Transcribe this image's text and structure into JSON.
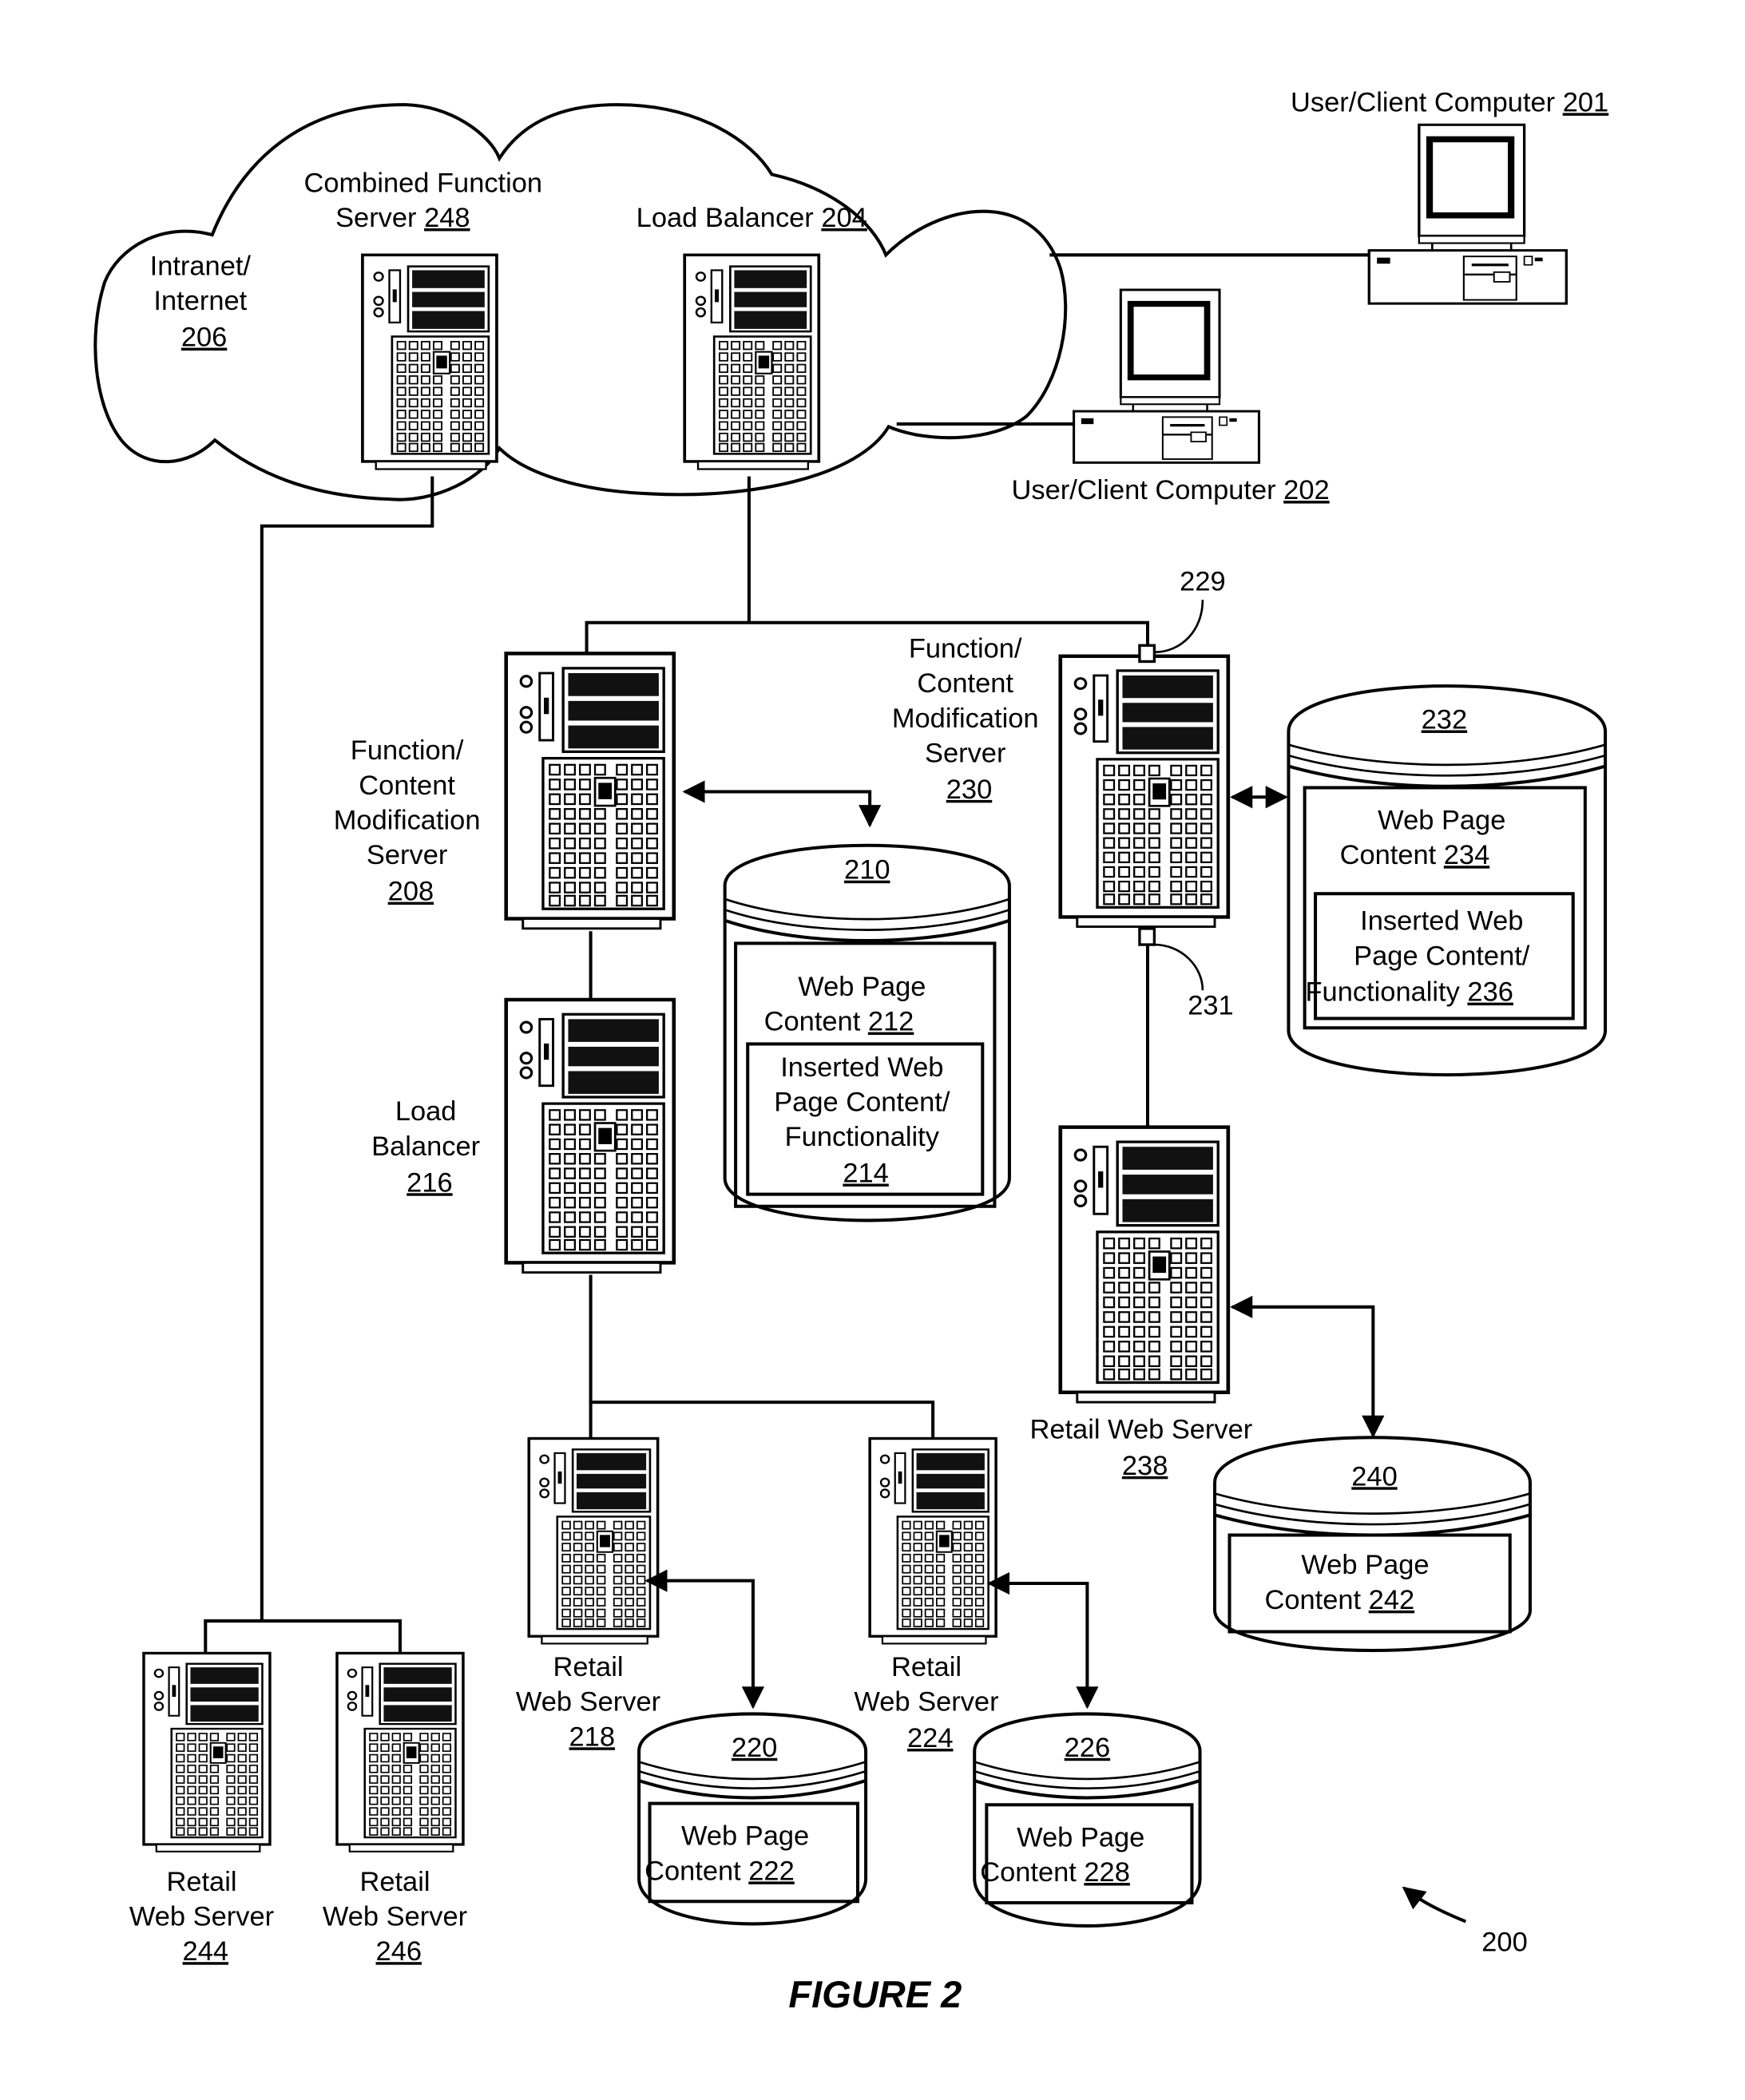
{
  "figure": {
    "caption": "FIGURE 2",
    "reference_numeral": "200"
  },
  "network": {
    "lines": [
      "Intranet/",
      "Internet"
    ],
    "ref": "206"
  },
  "clients": [
    {
      "id": "client-201",
      "text": "User/Client Computer ",
      "ref": "201"
    },
    {
      "id": "client-202",
      "text": "User/Client Computer ",
      "ref": "202"
    }
  ],
  "servers": {
    "combined_function_248": {
      "lines": [
        "Combined Function",
        "Server "
      ],
      "ref": "248"
    },
    "load_balancer_204": {
      "lines": [
        "Load Balancer "
      ],
      "ref": "204"
    },
    "modification_208": {
      "lines": [
        "Function/",
        "Content",
        "Modification",
        "Server"
      ],
      "ref": "208"
    },
    "modification_230": {
      "lines": [
        "Function/",
        "Content",
        "Modification",
        "Server"
      ],
      "ref": "230"
    },
    "load_balancer_216": {
      "lines": [
        "Load",
        "Balancer"
      ],
      "ref": "216"
    },
    "retail_218": {
      "lines": [
        "Retail",
        "Web Server"
      ],
      "ref": "218"
    },
    "retail_224": {
      "lines": [
        "Retail",
        "Web Server"
      ],
      "ref": "224"
    },
    "retail_238": {
      "lines": [
        "Retail Web Server"
      ],
      "ref": "238"
    },
    "retail_244": {
      "lines": [
        "Retail",
        "Web Server"
      ],
      "ref": "244"
    },
    "retail_246": {
      "lines": [
        "Retail",
        "Web Server"
      ],
      "ref": "246"
    }
  },
  "ports": {
    "port_229": "229",
    "port_231": "231"
  },
  "databases": {
    "db_210": {
      "ref": "210",
      "content": {
        "lines": [
          "Web Page",
          "Content "
        ],
        "ref": "212"
      },
      "inserted": {
        "lines": [
          "Inserted Web",
          "Page Content/",
          "Functionality"
        ],
        "ref": "214"
      }
    },
    "db_232": {
      "ref": "232",
      "content": {
        "lines": [
          "Web Page",
          "Content "
        ],
        "ref": "234"
      },
      "inserted": {
        "lines": [
          "Inserted Web",
          "Page Content/",
          "Functionality "
        ],
        "ref": "236"
      }
    },
    "db_220": {
      "ref": "220",
      "content": {
        "lines": [
          "Web Page",
          "Content "
        ],
        "ref": "222"
      }
    },
    "db_226": {
      "ref": "226",
      "content": {
        "lines": [
          "Web Page",
          "Content "
        ],
        "ref": "228"
      }
    },
    "db_240": {
      "ref": "240",
      "content": {
        "lines": [
          "Web Page",
          "Content "
        ],
        "ref": "242"
      }
    }
  }
}
